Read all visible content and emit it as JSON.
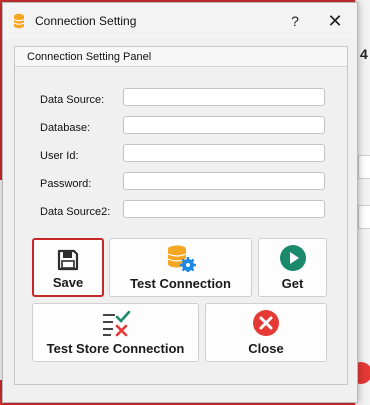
{
  "window": {
    "title": "Connection Setting",
    "help_glyph": "?",
    "close_glyph": "✕"
  },
  "panel": {
    "title": "Connection Setting Panel"
  },
  "fields": [
    {
      "label": "Data Source:",
      "value": ""
    },
    {
      "label": "Database:",
      "value": ""
    },
    {
      "label": "User Id:",
      "value": ""
    },
    {
      "label": "Password:",
      "value": ""
    },
    {
      "label": "Data Source2:",
      "value": ""
    }
  ],
  "buttons": {
    "save": {
      "label": "Save",
      "icon": "floppy-disk-icon"
    },
    "test_connection": {
      "label": "Test Connection",
      "icon": "database-gear-icon"
    },
    "get": {
      "label": "Get",
      "icon": "play-circle-icon"
    },
    "test_store_connection": {
      "label": "Test Store Connection",
      "icon": "checklist-icon"
    },
    "close": {
      "label": "Close",
      "icon": "close-circle-icon"
    }
  },
  "background": {
    "partial_number": "4"
  },
  "colors": {
    "accent_red": "#c62828",
    "get_teal": "#1b8a6b",
    "db_orange": "#f5a623",
    "gear_blue": "#1e88e5",
    "close_red": "#e53935"
  }
}
